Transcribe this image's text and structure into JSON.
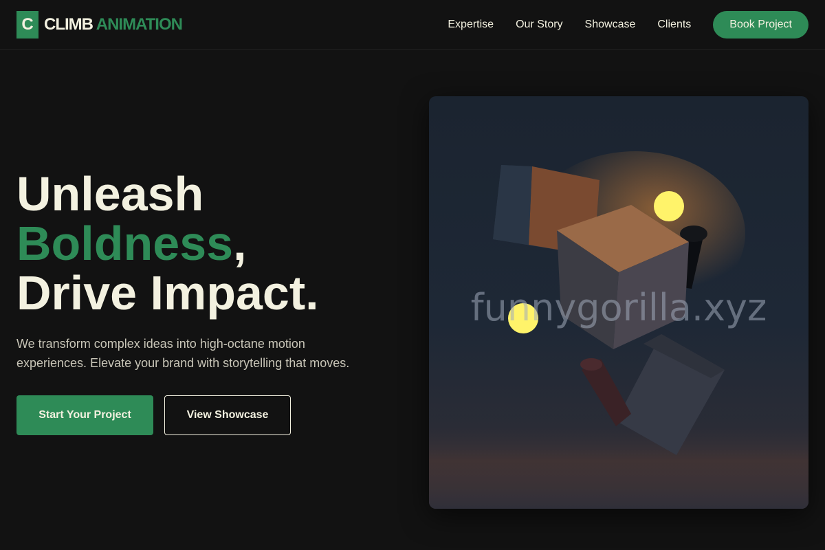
{
  "brand": {
    "mark": "C",
    "name_part1": "CLIMB",
    "name_part2": "ANIMATION",
    "accent_color": "#2e8b57"
  },
  "nav": {
    "links": [
      "Expertise",
      "Our Story",
      "Showcase",
      "Clients"
    ],
    "cta_label": "Book Project"
  },
  "hero": {
    "title_line1": "Unleash",
    "title_accent": "Boldness",
    "title_comma": ",",
    "title_line3": "Drive Impact.",
    "subtitle": "We transform complex ideas into high-octane motion experiences. Elevate your brand with storytelling that moves.",
    "primary_cta": "Start Your Project",
    "secondary_cta": "View Showcase",
    "image_watermark": "funnygorilla.xyz",
    "image_icon": "abstract-3d-cubes-image"
  },
  "colors": {
    "background": "#121212",
    "text": "#f3f1e0",
    "muted": "#c9c6b8"
  }
}
